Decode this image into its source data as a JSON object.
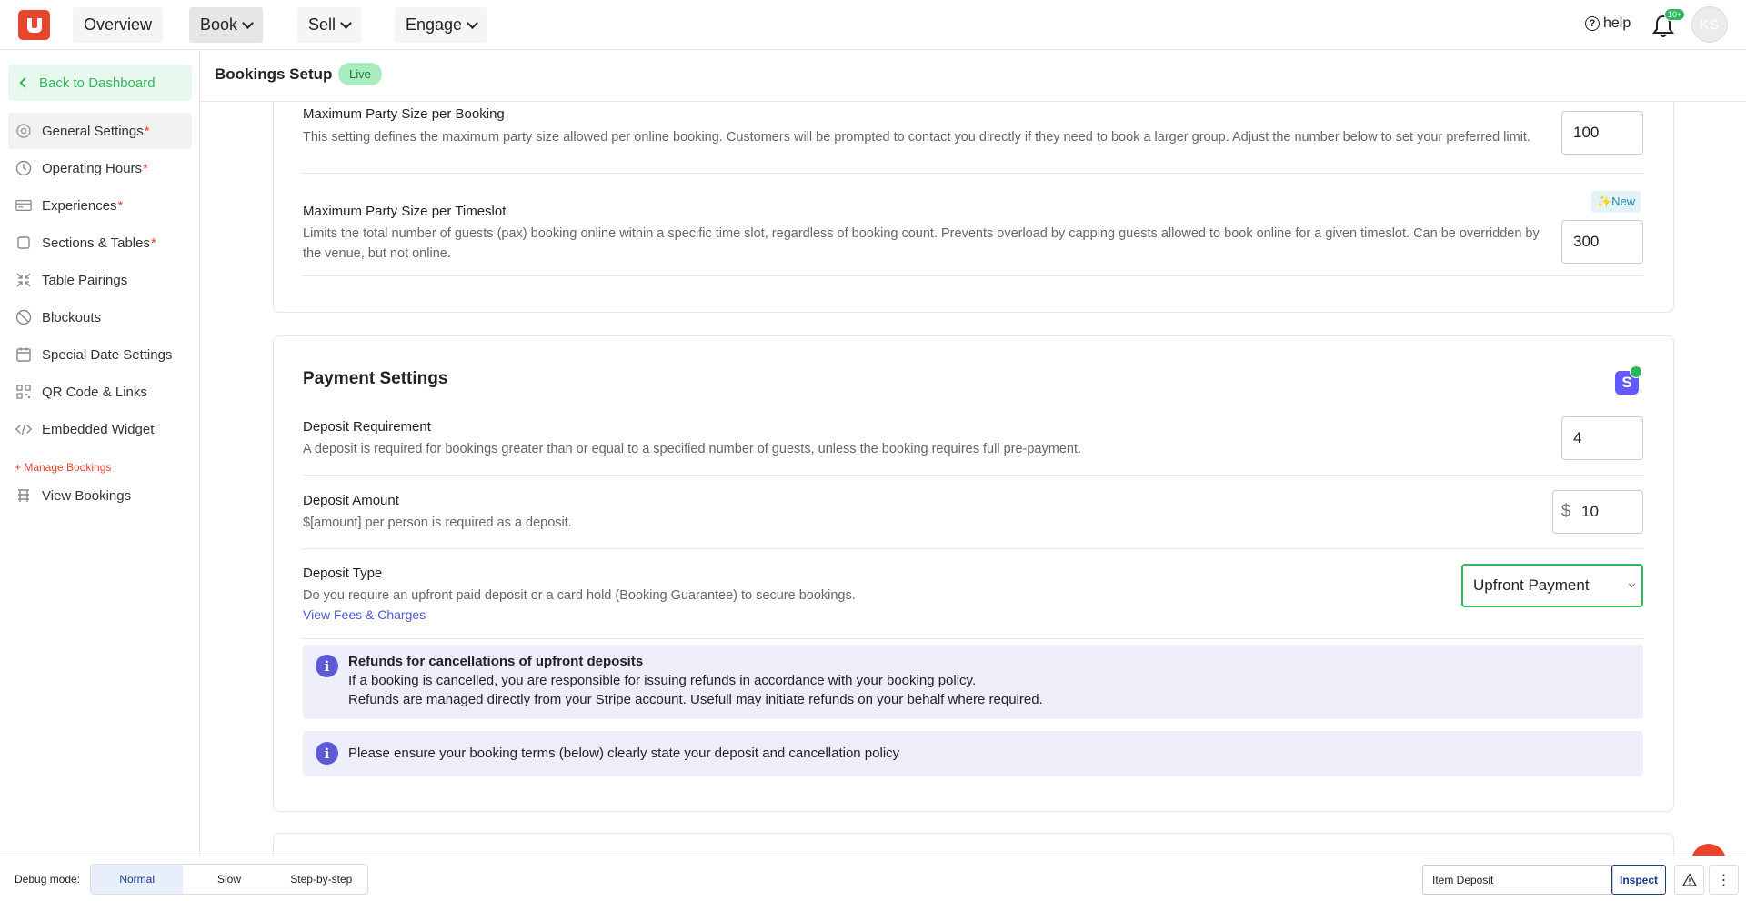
{
  "topbar": {
    "nav": [
      "Overview",
      "Book",
      "Sell",
      "Engage"
    ],
    "help": "help",
    "notif_badge": "10+",
    "avatar_initials": "KS"
  },
  "sidebar": {
    "back": "Back to Dashboard",
    "items": [
      {
        "label": "General Settings",
        "req": "*"
      },
      {
        "label": "Operating Hours",
        "req": "*"
      },
      {
        "label": "Experiences",
        "req": "*"
      },
      {
        "label": "Sections & Tables",
        "req": "*"
      },
      {
        "label": "Table Pairings",
        "req": ""
      },
      {
        "label": "Blockouts",
        "req": ""
      },
      {
        "label": "Special Date Settings",
        "req": ""
      },
      {
        "label": "QR Code & Links",
        "req": ""
      },
      {
        "label": "Embedded Widget",
        "req": ""
      }
    ],
    "section_label": "+ Manage Bookings",
    "view_bookings": "View Bookings"
  },
  "header": {
    "title": "Bookings Setup",
    "status": "Live"
  },
  "party": {
    "max_booking_title": "Maximum Party Size per Booking",
    "max_booking_desc": "This setting defines the maximum party size allowed per online booking. Customers will be prompted to contact you directly if they need to book a larger group. Adjust the number below to set your preferred limit.",
    "max_booking_value": "100",
    "max_timeslot_title": "Maximum Party Size per Timeslot",
    "max_timeslot_desc": "Limits the total number of guests (pax) booking online within a specific time slot, regardless of booking count. Prevents overload by capping guests allowed to book online for a given timeslot. Can be overridden by the venue, but not online.",
    "max_timeslot_value": "300",
    "new_badge": "✨New"
  },
  "payment": {
    "title": "Payment Settings",
    "stripe_icon": "S",
    "deposit_req_title": "Deposit Requirement",
    "deposit_req_desc": "A deposit is required for bookings greater than or equal to a specified number of guests, unless the booking requires full pre-payment.",
    "deposit_req_value": "4",
    "deposit_amount_title": "Deposit Amount",
    "deposit_amount_desc": "$[amount] per person is required as a deposit.",
    "currency": "$",
    "deposit_amount_value": "10",
    "deposit_type_title": "Deposit Type",
    "deposit_type_desc": "Do you require an upfront paid deposit or a card hold (Booking Guarantee) to secure bookings.",
    "view_fees": "View Fees & Charges",
    "deposit_type_value": "Upfront Payment",
    "info1_title": "Refunds for cancellations of upfront deposits",
    "info1_line1": "If a booking is cancelled, you are responsible for issuing refunds in accordance with your booking policy.",
    "info1_line2": "Refunds are managed directly from your Stripe account. Usefull may initiate refunds on your behalf where required.",
    "info2": "Please ensure your booking terms (below) clearly state your deposit and cancellation policy"
  },
  "debug": {
    "label": "Debug mode:",
    "modes": [
      "Normal",
      "Slow",
      "Step-by-step"
    ],
    "input_value": "Item Deposit",
    "inspect": "Inspect"
  },
  "colors": {
    "brand": "#e8452e",
    "accent_green": "#2eb85c",
    "stripe": "#635bff"
  }
}
